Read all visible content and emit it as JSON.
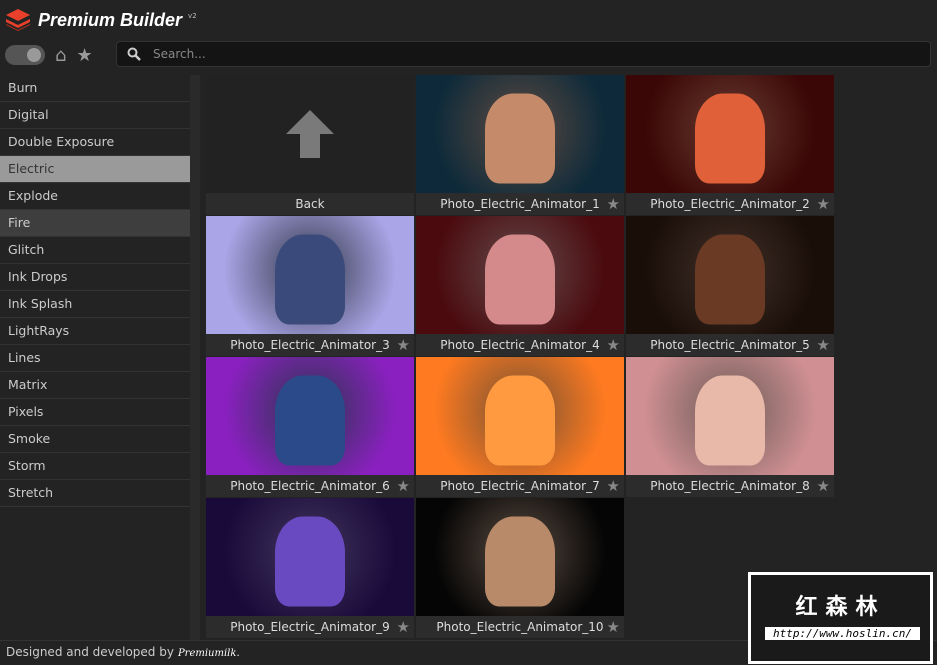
{
  "app": {
    "title": "Premium Builder",
    "version": "v2"
  },
  "toolbar": {
    "search_placeholder": "Search..."
  },
  "sidebar": {
    "items": [
      "Burn",
      "Digital",
      "Double Exposure",
      "Electric",
      "Explode",
      "Fire",
      "Glitch",
      "Ink Drops",
      "Ink Splash",
      "LightRays",
      "Lines",
      "Matrix",
      "Pixels",
      "Smoke",
      "Storm",
      "Stretch"
    ],
    "selected": "Electric"
  },
  "grid": {
    "back_label": "Back",
    "items": [
      {
        "label": "Photo_Electric_Animator_1",
        "bg": "#0e2a3a",
        "fig": "#c48a6a"
      },
      {
        "label": "Photo_Electric_Animator_2",
        "bg": "#3a0606",
        "fig": "#e0603a"
      },
      {
        "label": "Photo_Electric_Animator_3",
        "bg": "#a9a5e6",
        "fig": "#3a4a7a"
      },
      {
        "label": "Photo_Electric_Animator_4",
        "bg": "#4a0a0e",
        "fig": "#d48a8a"
      },
      {
        "label": "Photo_Electric_Animator_5",
        "bg": "#1a0e08",
        "fig": "#6a3a24"
      },
      {
        "label": "Photo_Electric_Animator_6",
        "bg": "#8a20c0",
        "fig": "#2a4a8a"
      },
      {
        "label": "Photo_Electric_Animator_7",
        "bg": "#ff7a20",
        "fig": "#ff9a40"
      },
      {
        "label": "Photo_Electric_Animator_8",
        "bg": "#cf8f93",
        "fig": "#e8b8a8"
      },
      {
        "label": "Photo_Electric_Animator_9",
        "bg": "#1a0a3a",
        "fig": "#6a4ac0"
      },
      {
        "label": "Photo_Electric_Animator_10",
        "bg": "#050505",
        "fig": "#b88a6a"
      }
    ]
  },
  "footer": {
    "text": "Designed and developed by",
    "brand": "Premiumilk."
  },
  "watermark": {
    "chars": "红森林",
    "url": "http://www.hoslin.cn/"
  }
}
